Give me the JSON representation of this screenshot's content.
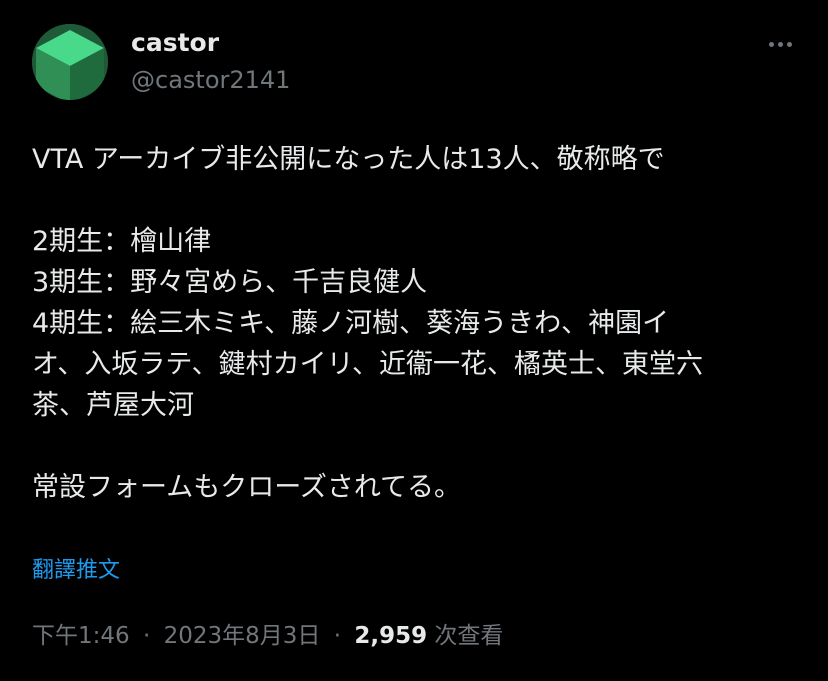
{
  "author": {
    "display_name": "castor",
    "handle": "@castor2141",
    "avatar_icon": "green-cube-avatar",
    "avatar_colors": [
      "#2f8f55",
      "#48d98a",
      "#1f6b3d"
    ]
  },
  "tweet": {
    "lines": [
      "VTA アーカイブ非公開になった人は13人、敬称略で",
      "",
      "2期生：檜山律",
      "3期生：野々宮めら、千吉良健人",
      "4期生：絵三木ミキ、藤ノ河樹、葵海うきわ、神園イ",
      "オ、入坂ラテ、鍵村カイリ、近衞一花、橘英士、東堂六",
      "茶、芦屋大河",
      "",
      "常設フォームもクローズされてる。"
    ],
    "translate_label": "翻譯推文"
  },
  "meta": {
    "time": "下午1:46",
    "date": "2023年8月3日",
    "separator": "·",
    "views_count": "2,959",
    "views_label": "次查看"
  },
  "icons": {
    "more": "more-horizontal-icon"
  },
  "colors": {
    "background": "#000000",
    "primary_text": "#e7e9ea",
    "secondary_text": "#71767b",
    "link": "#1d9bf0"
  }
}
